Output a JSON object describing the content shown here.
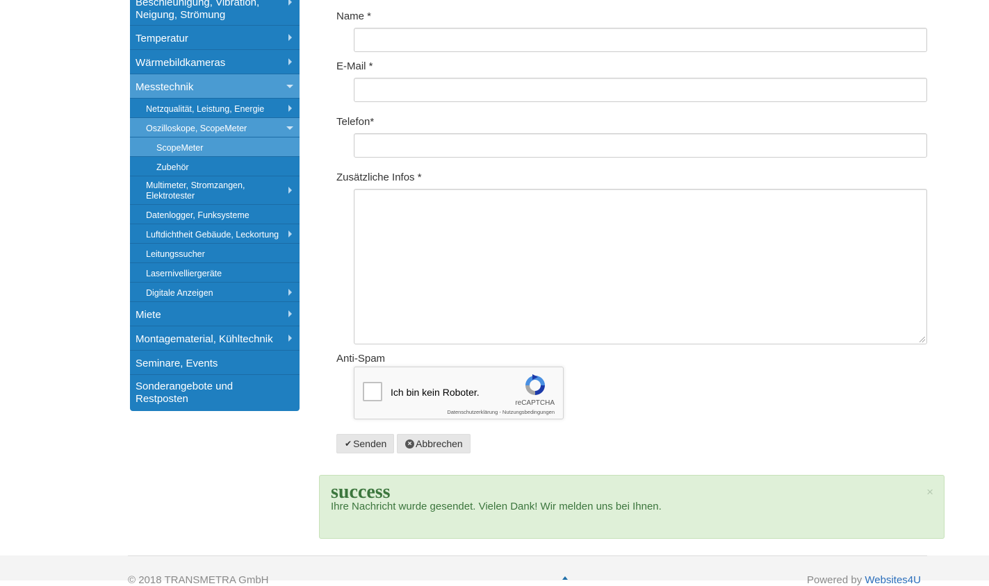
{
  "sidebar": {
    "items": [
      {
        "label": "Beschleunigung, Vibration, Neigung, Strömung",
        "level": 1
      },
      {
        "label": "Temperatur",
        "level": 1
      },
      {
        "label": "Wärmebildkameras",
        "level": 1
      },
      {
        "label": "Messtechnik",
        "level": 1,
        "expanded": true
      },
      {
        "label": "Netzqualität, Leistung, Energie",
        "level": 2
      },
      {
        "label": "Oszilloskope, ScopeMeter",
        "level": 2,
        "expanded": true
      },
      {
        "label": "ScopeMeter",
        "level": 3,
        "active": true
      },
      {
        "label": "Zubehör",
        "level": 3
      },
      {
        "label": "Multimeter, Stromzangen, Elektrotester",
        "level": 2
      },
      {
        "label": "Datenlogger, Funksysteme",
        "level": 2
      },
      {
        "label": "Luftdichtheit Gebäude, Leckortung",
        "level": 2
      },
      {
        "label": "Leitungssucher",
        "level": 2
      },
      {
        "label": "Lasernivelliergeräte",
        "level": 2
      },
      {
        "label": "Digitale Anzeigen",
        "level": 2
      },
      {
        "label": "Miete",
        "level": 1
      },
      {
        "label": "Montagematerial, Kühltechnik",
        "level": 1
      },
      {
        "label": "Seminare, Events",
        "level": 1
      },
      {
        "label": "Sonderangebote und Restposten",
        "level": 1
      }
    ]
  },
  "form": {
    "name_label": "Name *",
    "name_value": "",
    "email_label": "E-Mail *",
    "email_value": "",
    "phone_label": "Telefon*",
    "phone_value": "",
    "info_label": "Zusätzliche Infos *",
    "info_value": "",
    "antispam_label": "Anti-Spam"
  },
  "captcha": {
    "checkbox_text": "Ich bin kein Roboter.",
    "brand": "reCAPTCHA",
    "links": "Datenschutzerklärung - Nutzungsbedingungen"
  },
  "buttons": {
    "send": "Senden",
    "cancel": "Abbrechen"
  },
  "alert": {
    "title": "success",
    "message": "Ihre Nachricht wurde gesendet. Vielen Dank! Wir melden uns bei Ihnen.",
    "close": "×"
  },
  "footer": {
    "copyright": "© 2018 TRANSMETRA GmbH",
    "powered_prefix": "Powered by ",
    "powered_link": "Websites4U"
  },
  "colors": {
    "sidebar_bg": "#1f7fc0",
    "sidebar_active": "#4a9bd2",
    "alert_bg": "#dff0d8",
    "alert_text": "#3c763d"
  }
}
